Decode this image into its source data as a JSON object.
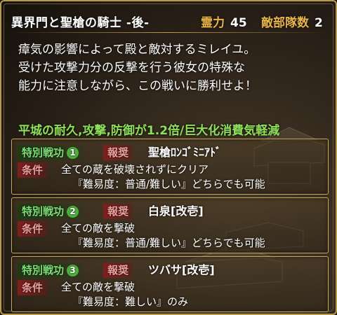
{
  "header": {
    "title": "異界門と聖槍の騎士 -後-",
    "spirit_label": "霊力",
    "spirit_value": "45",
    "enemy_label": "敵部隊数",
    "enemy_value": "2"
  },
  "description": [
    "瘴気の影響によって殿と敵対するミレイユ。",
    "受けた攻撃力分の反撃を行う彼女の特殊な",
    "能力に注意しながら、この戦いに勝利せよ！"
  ],
  "bonus_text": "平城の耐久,攻撃,防御が1.2倍/巨大化消費気軽減",
  "achievements": [
    {
      "tag": "特別戦功",
      "number": "1",
      "reward_label": "報奨",
      "reward": "聖槍ﾛﾝｺﾞﾐﾆｱﾄﾞ",
      "condition_label": "条件",
      "condition": "全ての蔵を破壊されずにクリア",
      "condition_sub": "『難易度：普通/難しい』どちらでも可能"
    },
    {
      "tag": "特別戦功",
      "number": "2",
      "reward_label": "報奨",
      "reward": "白泉[改壱]",
      "condition_label": "条件",
      "condition": "全ての敵を撃破",
      "condition_sub": "『難易度：普通/難しい』どちらでも可能"
    },
    {
      "tag": "特別戦功",
      "number": "3",
      "reward_label": "報奨",
      "reward": "ツバサ[改壱]",
      "condition_label": "条件",
      "condition": "全ての敵を撃破",
      "condition_sub": "『難易度：難しい』のみ"
    }
  ],
  "colors": {
    "frame": "#b89a4e",
    "bonus_green": "#8ee05a",
    "label_orange": "#e8b44a",
    "tag_red": "#821e1e",
    "tag_green": "#4cae3c"
  }
}
